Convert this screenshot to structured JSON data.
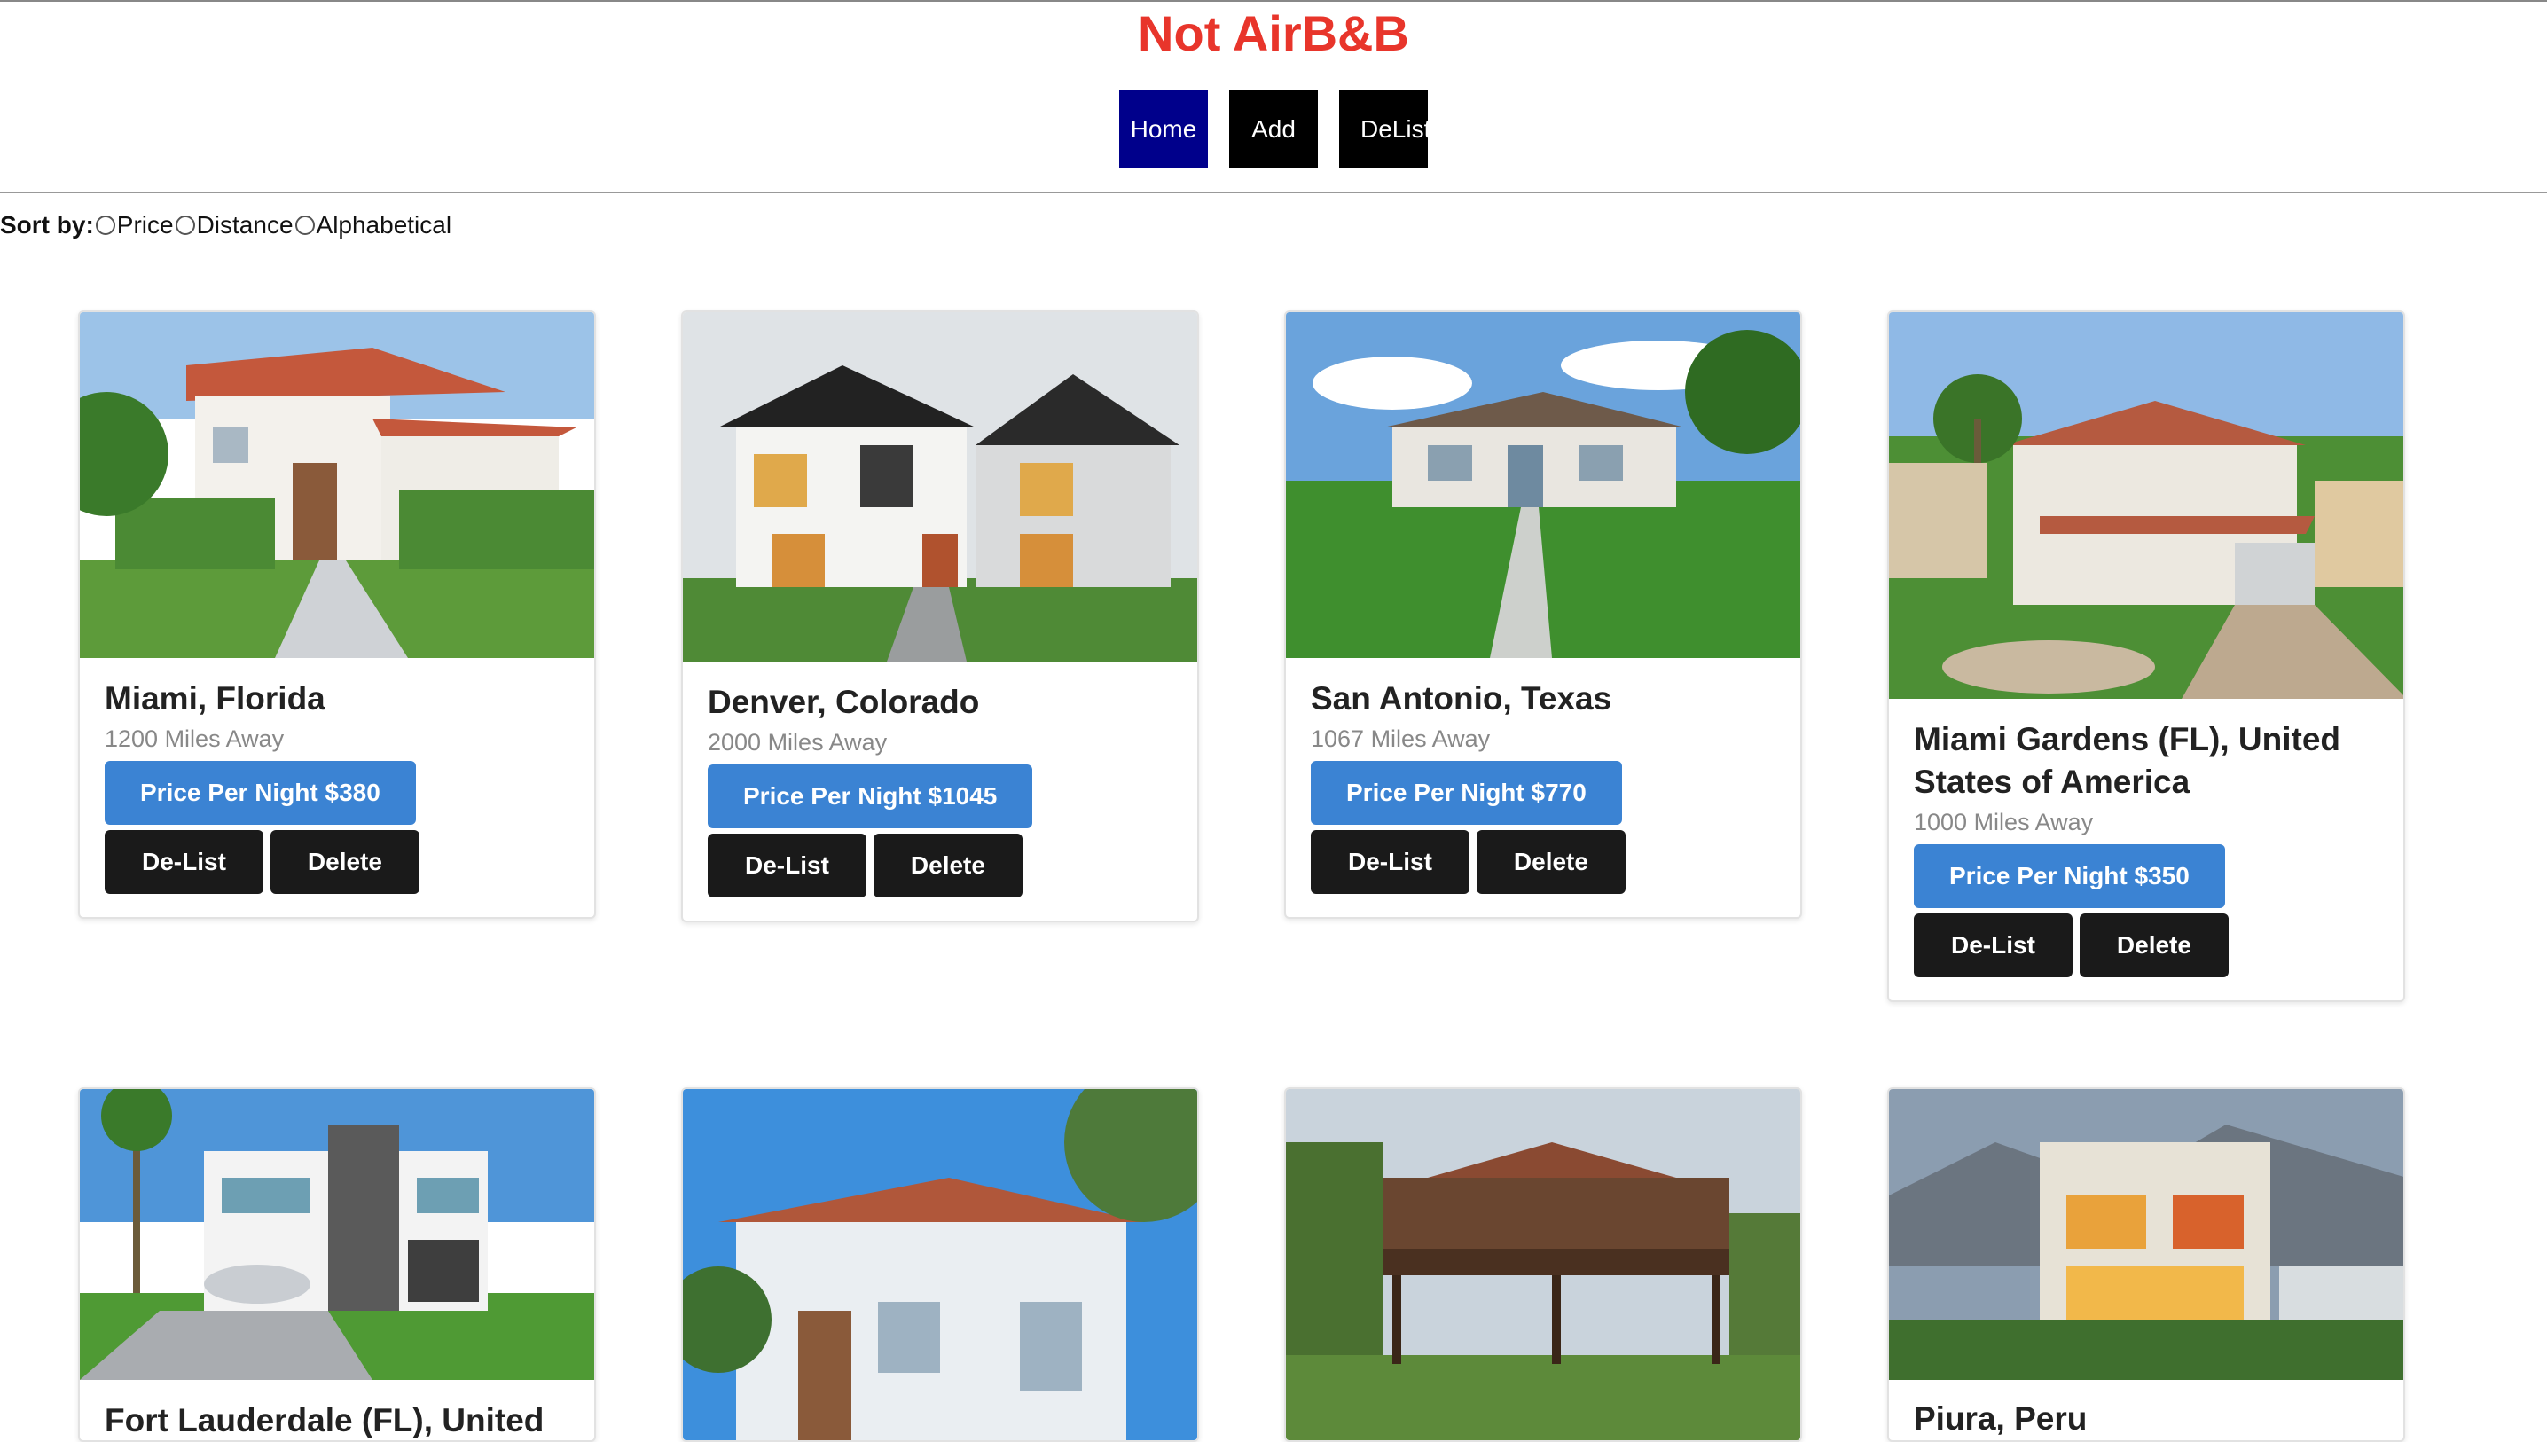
{
  "header": {
    "title": "Not AirB&B",
    "nav": [
      {
        "label": "Home",
        "active": true
      },
      {
        "label": "Add",
        "active": false
      },
      {
        "label": "DeList",
        "active": false
      }
    ]
  },
  "sort": {
    "label": "Sort by:",
    "options": [
      "Price",
      "Distance",
      "Alphabetical"
    ]
  },
  "colors": {
    "title": "#e8352b",
    "nav_active": "#00008b",
    "nav_default": "#000000",
    "price_button": "#3b83d3",
    "action_button": "#1a1a1a"
  },
  "listings": [
    {
      "location": "Miami, Florida",
      "distance": "1200 Miles Away",
      "price": "Price Per Night $380",
      "delist": "De-List",
      "delete": "Delete"
    },
    {
      "location": "Denver, Colorado",
      "distance": "2000 Miles Away",
      "price": "Price Per Night $1045",
      "delist": "De-List",
      "delete": "Delete"
    },
    {
      "location": "San Antonio, Texas",
      "distance": "1067 Miles Away",
      "price": "Price Per Night $770",
      "delist": "De-List",
      "delete": "Delete"
    },
    {
      "location": "Miami Gardens (FL), United States of America",
      "distance": "1000 Miles Away",
      "price": "Price Per Night $350",
      "delist": "De-List",
      "delete": "Delete"
    },
    {
      "location": "Fort Lauderdale (FL), United",
      "distance": "",
      "price": "",
      "delist": "",
      "delete": ""
    },
    {
      "location": "",
      "distance": "",
      "price": "",
      "delist": "",
      "delete": ""
    },
    {
      "location": "",
      "distance": "",
      "price": "",
      "delist": "",
      "delete": ""
    },
    {
      "location": "Piura, Peru",
      "distance": "",
      "price": "",
      "delist": "",
      "delete": ""
    }
  ]
}
